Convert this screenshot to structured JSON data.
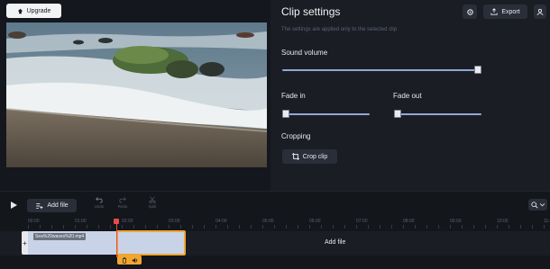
{
  "header": {
    "upgrade_label": "Upgrade"
  },
  "settings": {
    "title": "Clip settings",
    "subtitle": "The settings are applied only to the selected clip",
    "export_label": "Export",
    "sound_volume_label": "Sound volume",
    "sound_volume_level": 1.0,
    "fade_in_label": "Fade in",
    "fade_in_level": 0.0,
    "fade_out_label": "Fade out",
    "fade_out_level": 0.0,
    "cropping_label": "Cropping",
    "crop_button_label": "Crop clip"
  },
  "timeline": {
    "add_file_label": "Add file",
    "tools": [
      "Undo",
      "Redo",
      "Split"
    ],
    "ruler_labels": [
      "00:00",
      "01:00",
      "02:00",
      "03:00",
      "04:00",
      "05:00",
      "06:00",
      "07:00",
      "08:00",
      "09:00",
      "10:00",
      "11:00"
    ],
    "clip_name": "Sea%20waves%20.mp4",
    "add_file_track_label": "Add file"
  },
  "colors": {
    "accent": "#f0a630",
    "playhead": "#e84a4a",
    "slider": "#8fa9d8"
  },
  "icons": [
    "upgrade-icon",
    "gear-icon",
    "export-icon",
    "user-icon",
    "crop-icon",
    "play-icon",
    "add-file-icon",
    "undo-icon",
    "redo-icon",
    "scissors-icon",
    "zoom-icon",
    "delete-icon",
    "volume-icon"
  ]
}
